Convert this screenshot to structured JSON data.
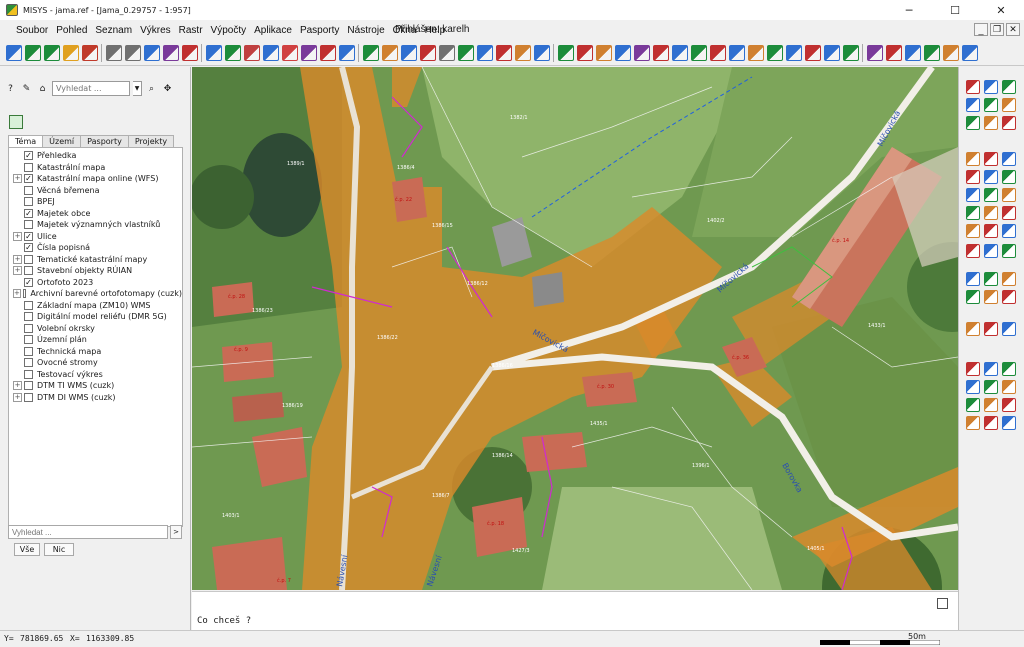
{
  "window": {
    "title": "MISYS - jama.ref - [Jama_0.29757 - 1:957]",
    "minimize": "─",
    "maximize": "☐",
    "close": "✕"
  },
  "menubar": {
    "items": [
      "Soubor",
      "Pohled",
      "Seznam",
      "Výkres",
      "Rastr",
      "Výpočty",
      "Aplikace",
      "Pasporty",
      "Nástroje",
      "Okna",
      "Help"
    ],
    "logged_user": "Přihlášen: karelh",
    "mdi_minimize": "_",
    "mdi_restore": "❐",
    "mdi_close": "✕"
  },
  "left_panel": {
    "help_btn": "?",
    "search_placeholder": "Vyhledat ...",
    "dropdown_arrow": "▼",
    "search_btn": "⌕",
    "pin_btn": "✥",
    "tabs": [
      "Téma",
      "Území",
      "Pasporty",
      "Projekty"
    ],
    "active_tab": "Téma",
    "layers": [
      {
        "label": "Přehledka",
        "checked": true,
        "expandable": false
      },
      {
        "label": "Katastrální mapa",
        "checked": false,
        "expandable": false
      },
      {
        "label": "Katastrální mapa online (WFS)",
        "checked": true,
        "expandable": true
      },
      {
        "label": "Věcná břemena",
        "checked": false,
        "expandable": false
      },
      {
        "label": "BPEJ",
        "checked": false,
        "expandable": false
      },
      {
        "label": "Majetek obce",
        "checked": true,
        "expandable": false
      },
      {
        "label": "Majetek významných vlastníků",
        "checked": false,
        "expandable": false
      },
      {
        "label": "Ulice",
        "checked": true,
        "expandable": true
      },
      {
        "label": "Čísla popisná",
        "checked": true,
        "expandable": false
      },
      {
        "label": "Tematické katastrální mapy",
        "checked": false,
        "expandable": true
      },
      {
        "label": "Stavební objekty RÚIAN",
        "checked": false,
        "expandable": true
      },
      {
        "label": "Ortofoto 2023",
        "checked": true,
        "expandable": false
      },
      {
        "label": "Archivní barevné ortofotomapy (cuzk)",
        "checked": false,
        "expandable": true
      },
      {
        "label": "Základní mapa (ZM10) WMS",
        "checked": false,
        "expandable": false
      },
      {
        "label": "Digitální model reliéfu (DMR 5G)",
        "checked": false,
        "expandable": false
      },
      {
        "label": "Volební okrsky",
        "checked": false,
        "expandable": false
      },
      {
        "label": "Územní plán",
        "checked": false,
        "expandable": false
      },
      {
        "label": "Technická mapa",
        "checked": false,
        "expandable": false
      },
      {
        "label": "Ovocné stromy",
        "checked": false,
        "expandable": false
      },
      {
        "label": "Testovací výkres",
        "checked": false,
        "expandable": false
      },
      {
        "label": "DTM TI WMS (cuzk)",
        "checked": false,
        "expandable": true
      },
      {
        "label": "DTM DI WMS (cuzk)",
        "checked": false,
        "expandable": true
      }
    ],
    "bottom_search_placeholder": "Vyhledat ...",
    "bottom_go": ">",
    "all_btn": "Vše",
    "none_btn": "Nic"
  },
  "map": {
    "street_labels": [
      "Míčovická",
      "Míčovická",
      "Míčovická",
      "Borovka",
      "Návesní",
      "Návesní"
    ],
    "parcel_labels": [
      "1389/1",
      "1386/4",
      "1386/22",
      "1386/23",
      "1386/15",
      "1386/7",
      "1386/12",
      "1386/14",
      "1386/19",
      "1386/16",
      "1402/2",
      "1435/1",
      "1433/1",
      "1396/1",
      "1403/1",
      "1405/1",
      "1427/3",
      "1382/1"
    ],
    "building_labels": [
      "č.p. 22",
      "č.p. 36",
      "č.p. 14",
      "č.p. 28",
      "č.p. 9",
      "č.p. 30",
      "č.p. 18",
      "č.p. 7"
    ]
  },
  "command": {
    "prompt": "Co chceš  ?"
  },
  "statusbar": {
    "y_label": "Y=",
    "y_value": "781869.65",
    "x_label": "X=",
    "x_value": "1163309.85",
    "scale_label": "50m"
  },
  "colors": {
    "orange_parcel": "#d98a2b",
    "road_white": "#f2efe8",
    "green_field": "#7fa857",
    "dark_green": "#4f7a3c",
    "roof_red": "#c96b55",
    "magenta_line": "#d02ad0",
    "blue_line": "#2060e0"
  },
  "icons": {
    "toolbar": [
      "new-file-icon",
      "zoom-in-icon",
      "zoom-out-icon",
      "print-icon",
      "globe-icon",
      "measure-icon",
      "layer-icon",
      "settings-icon"
    ]
  }
}
